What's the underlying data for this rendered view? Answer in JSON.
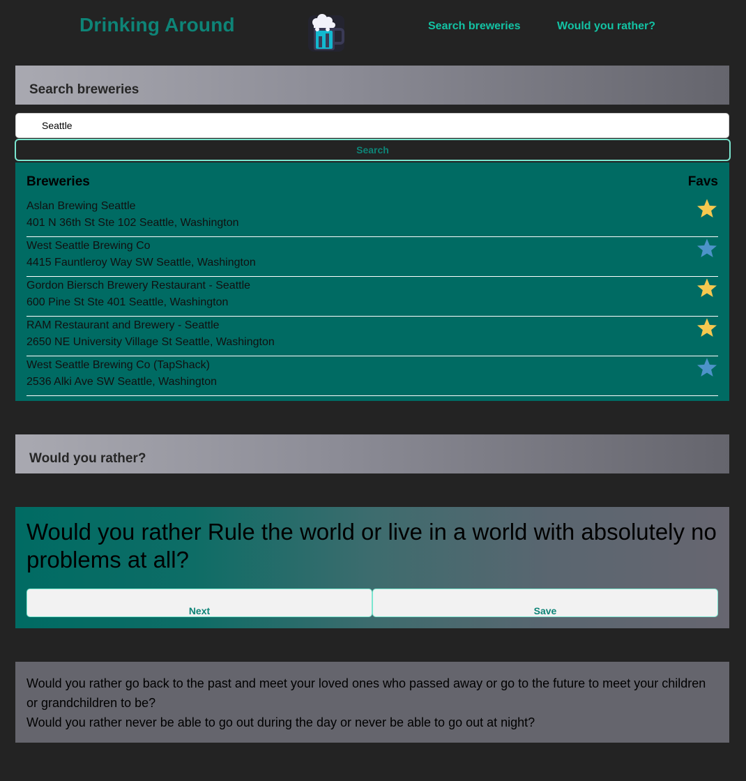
{
  "header": {
    "title": "Drinking Around",
    "logo_icon": "beer-mug-icon",
    "nav": [
      {
        "label": "Search breweries"
      },
      {
        "label": "Would you rather?"
      }
    ]
  },
  "search_section": {
    "heading": "Search breweries",
    "input_value": "Seattle",
    "button_label": "Search"
  },
  "breweries": {
    "heading": "Breweries",
    "favs_heading": "Favs",
    "items": [
      {
        "name": "Aslan Brewing Seattle",
        "address": "401 N 36th St Ste 102 Seattle, Washington",
        "fav": true,
        "star_color": "#f6c84f"
      },
      {
        "name": "West Seattle Brewing Co",
        "address": "4415 Fauntleroy Way SW Seattle, Washington",
        "fav": false,
        "star_color": "#4d93c9"
      },
      {
        "name": "Gordon Biersch Brewery Restaurant - Seattle",
        "address": "600 Pine St Ste 401 Seattle, Washington",
        "fav": true,
        "star_color": "#f6c84f"
      },
      {
        "name": "RAM Restaurant and Brewery - Seattle",
        "address": "2650 NE University Village St Seattle, Washington",
        "fav": true,
        "star_color": "#f6c84f"
      },
      {
        "name": "West Seattle Brewing Co (TapShack)",
        "address": "2536 Alki Ave SW Seattle, Washington",
        "fav": false,
        "star_color": "#4d93c9"
      }
    ]
  },
  "wyr_section": {
    "heading": "Would you rather?",
    "question": "Would you rather Rule the world or live in a world with absolutely no problems at all?",
    "next_label": "Next",
    "save_label": "Save"
  },
  "saved_questions": [
    "Would you rather go back to the past and meet your loved ones who passed away or go to the future to meet your children or grandchildren to be?",
    "Would you rather never be able to go out during the day or never be able to go out at night?"
  ],
  "colors": {
    "background": "#232323",
    "brand": "#0e8477",
    "accent": "#13c3a4",
    "panel": "#006b63",
    "star_fav": "#f6c84f",
    "star_unfav": "#4d93c9"
  }
}
